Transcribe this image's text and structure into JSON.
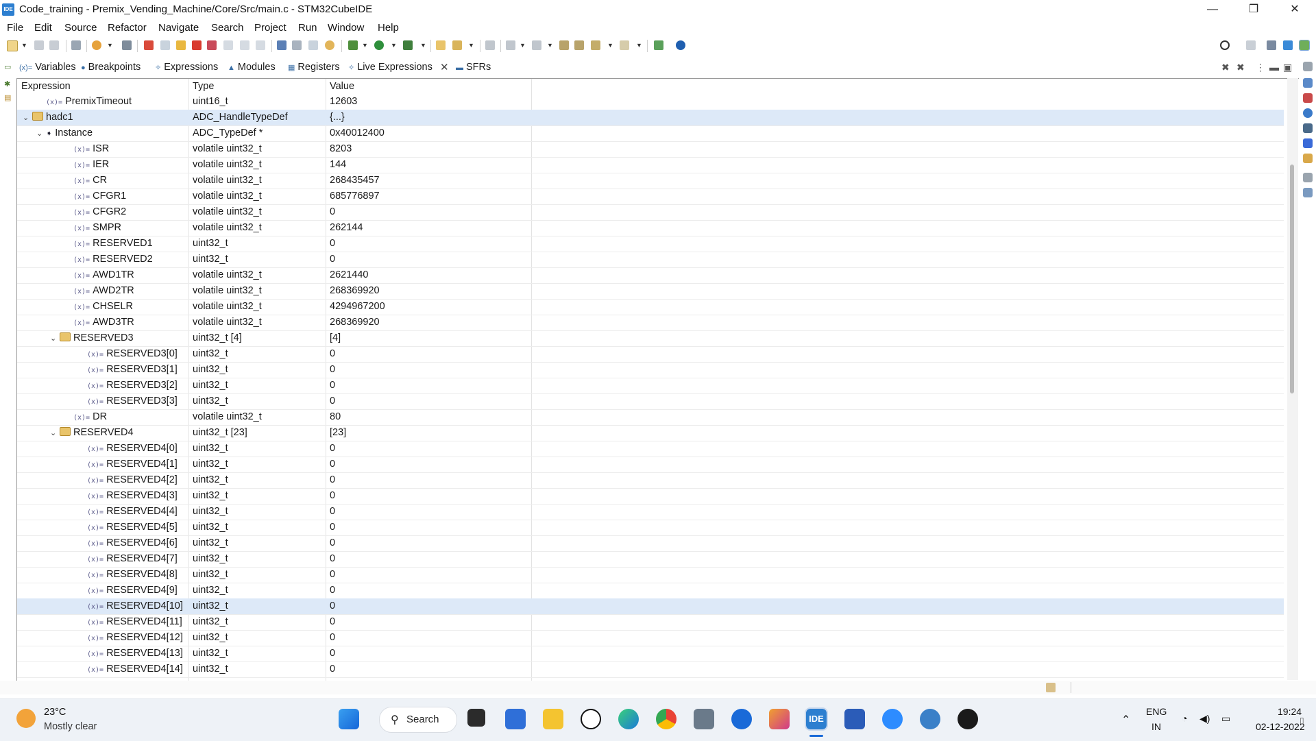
{
  "window": {
    "title": "Code_training - Premix_Vending_Machine/Core/Src/main.c - STM32CubeIDE",
    "app_icon_label": "IDE",
    "minimize_glyph": "—",
    "restore_glyph": "❐",
    "close_glyph": "✕"
  },
  "menu": [
    "File",
    "Edit",
    "Source",
    "Refactor",
    "Navigate",
    "Search",
    "Project",
    "Run",
    "Window",
    "Help"
  ],
  "view_tabs": {
    "variables": "Variables",
    "breakpoints": "Breakpoints",
    "expressions": "Expressions",
    "modules": "Modules",
    "registers": "Registers",
    "live_expressions": "Live Expressions",
    "sfrs": "SFRs",
    "close_glyph": "✕"
  },
  "table": {
    "headers": {
      "expression": "Expression",
      "type": "Type",
      "value": "Value"
    },
    "rows": [
      {
        "name": "PremixTimeout",
        "type": "uint16_t",
        "value": "12603",
        "level": 1,
        "icon": "variable",
        "twisty": ""
      },
      {
        "name": "hadc1",
        "type": "ADC_HandleTypeDef",
        "value": "{...}",
        "level": 0,
        "icon": "struct",
        "twisty": "v",
        "selected": true
      },
      {
        "name": "Instance",
        "type": "ADC_TypeDef *",
        "value": "0x40012400",
        "level": 1,
        "icon": "pointer",
        "twisty": "v"
      },
      {
        "name": "ISR",
        "type": "volatile uint32_t",
        "value": "8203",
        "level": 3,
        "icon": "variable",
        "twisty": ""
      },
      {
        "name": "IER",
        "type": "volatile uint32_t",
        "value": "144",
        "level": 3,
        "icon": "variable",
        "twisty": ""
      },
      {
        "name": "CR",
        "type": "volatile uint32_t",
        "value": "268435457",
        "level": 3,
        "icon": "variable",
        "twisty": ""
      },
      {
        "name": "CFGR1",
        "type": "volatile uint32_t",
        "value": "685776897",
        "level": 3,
        "icon": "variable",
        "twisty": ""
      },
      {
        "name": "CFGR2",
        "type": "volatile uint32_t",
        "value": "0",
        "level": 3,
        "icon": "variable",
        "twisty": ""
      },
      {
        "name": "SMPR",
        "type": "volatile uint32_t",
        "value": "262144",
        "level": 3,
        "icon": "variable",
        "twisty": ""
      },
      {
        "name": "RESERVED1",
        "type": "uint32_t",
        "value": "0",
        "level": 3,
        "icon": "variable",
        "twisty": ""
      },
      {
        "name": "RESERVED2",
        "type": "uint32_t",
        "value": "0",
        "level": 3,
        "icon": "variable",
        "twisty": ""
      },
      {
        "name": "AWD1TR",
        "type": "volatile uint32_t",
        "value": "2621440",
        "level": 3,
        "icon": "variable",
        "twisty": ""
      },
      {
        "name": "AWD2TR",
        "type": "volatile uint32_t",
        "value": "268369920",
        "level": 3,
        "icon": "variable",
        "twisty": ""
      },
      {
        "name": "CHSELR",
        "type": "volatile uint32_t",
        "value": "4294967200",
        "level": 3,
        "icon": "variable",
        "twisty": ""
      },
      {
        "name": "AWD3TR",
        "type": "volatile uint32_t",
        "value": "268369920",
        "level": 3,
        "icon": "variable",
        "twisty": ""
      },
      {
        "name": "RESERVED3",
        "type": "uint32_t [4]",
        "value": "[4]",
        "level": 2,
        "icon": "struct",
        "twisty": "v"
      },
      {
        "name": "RESERVED3[0]",
        "type": "uint32_t",
        "value": "0",
        "level": 4,
        "icon": "variable",
        "twisty": ""
      },
      {
        "name": "RESERVED3[1]",
        "type": "uint32_t",
        "value": "0",
        "level": 4,
        "icon": "variable",
        "twisty": ""
      },
      {
        "name": "RESERVED3[2]",
        "type": "uint32_t",
        "value": "0",
        "level": 4,
        "icon": "variable",
        "twisty": ""
      },
      {
        "name": "RESERVED3[3]",
        "type": "uint32_t",
        "value": "0",
        "level": 4,
        "icon": "variable",
        "twisty": ""
      },
      {
        "name": "DR",
        "type": "volatile uint32_t",
        "value": "80",
        "level": 3,
        "icon": "variable",
        "twisty": ""
      },
      {
        "name": "RESERVED4",
        "type": "uint32_t [23]",
        "value": "[23]",
        "level": 2,
        "icon": "struct",
        "twisty": "v"
      },
      {
        "name": "RESERVED4[0]",
        "type": "uint32_t",
        "value": "0",
        "level": 4,
        "icon": "variable",
        "twisty": ""
      },
      {
        "name": "RESERVED4[1]",
        "type": "uint32_t",
        "value": "0",
        "level": 4,
        "icon": "variable",
        "twisty": ""
      },
      {
        "name": "RESERVED4[2]",
        "type": "uint32_t",
        "value": "0",
        "level": 4,
        "icon": "variable",
        "twisty": ""
      },
      {
        "name": "RESERVED4[3]",
        "type": "uint32_t",
        "value": "0",
        "level": 4,
        "icon": "variable",
        "twisty": ""
      },
      {
        "name": "RESERVED4[4]",
        "type": "uint32_t",
        "value": "0",
        "level": 4,
        "icon": "variable",
        "twisty": ""
      },
      {
        "name": "RESERVED4[5]",
        "type": "uint32_t",
        "value": "0",
        "level": 4,
        "icon": "variable",
        "twisty": ""
      },
      {
        "name": "RESERVED4[6]",
        "type": "uint32_t",
        "value": "0",
        "level": 4,
        "icon": "variable",
        "twisty": ""
      },
      {
        "name": "RESERVED4[7]",
        "type": "uint32_t",
        "value": "0",
        "level": 4,
        "icon": "variable",
        "twisty": ""
      },
      {
        "name": "RESERVED4[8]",
        "type": "uint32_t",
        "value": "0",
        "level": 4,
        "icon": "variable",
        "twisty": ""
      },
      {
        "name": "RESERVED4[9]",
        "type": "uint32_t",
        "value": "0",
        "level": 4,
        "icon": "variable",
        "twisty": ""
      },
      {
        "name": "RESERVED4[10]",
        "type": "uint32_t",
        "value": "0",
        "level": 4,
        "icon": "variable",
        "twisty": "",
        "hover": true
      },
      {
        "name": "RESERVED4[11]",
        "type": "uint32_t",
        "value": "0",
        "level": 4,
        "icon": "variable",
        "twisty": ""
      },
      {
        "name": "RESERVED4[12]",
        "type": "uint32_t",
        "value": "0",
        "level": 4,
        "icon": "variable",
        "twisty": ""
      },
      {
        "name": "RESERVED4[13]",
        "type": "uint32_t",
        "value": "0",
        "level": 4,
        "icon": "variable",
        "twisty": ""
      },
      {
        "name": "RESERVED4[14]",
        "type": "uint32_t",
        "value": "0",
        "level": 4,
        "icon": "variable",
        "twisty": ""
      }
    ]
  },
  "taskbar": {
    "weather_temp": "23°C",
    "weather_desc": "Mostly clear",
    "search_label": "Search",
    "lang_top": "ENG",
    "lang_bottom": "IN",
    "time": "19:24",
    "date": "02-12-2022"
  },
  "colors": {
    "selection": "#dde9f8",
    "accent": "#2d7fd0"
  }
}
